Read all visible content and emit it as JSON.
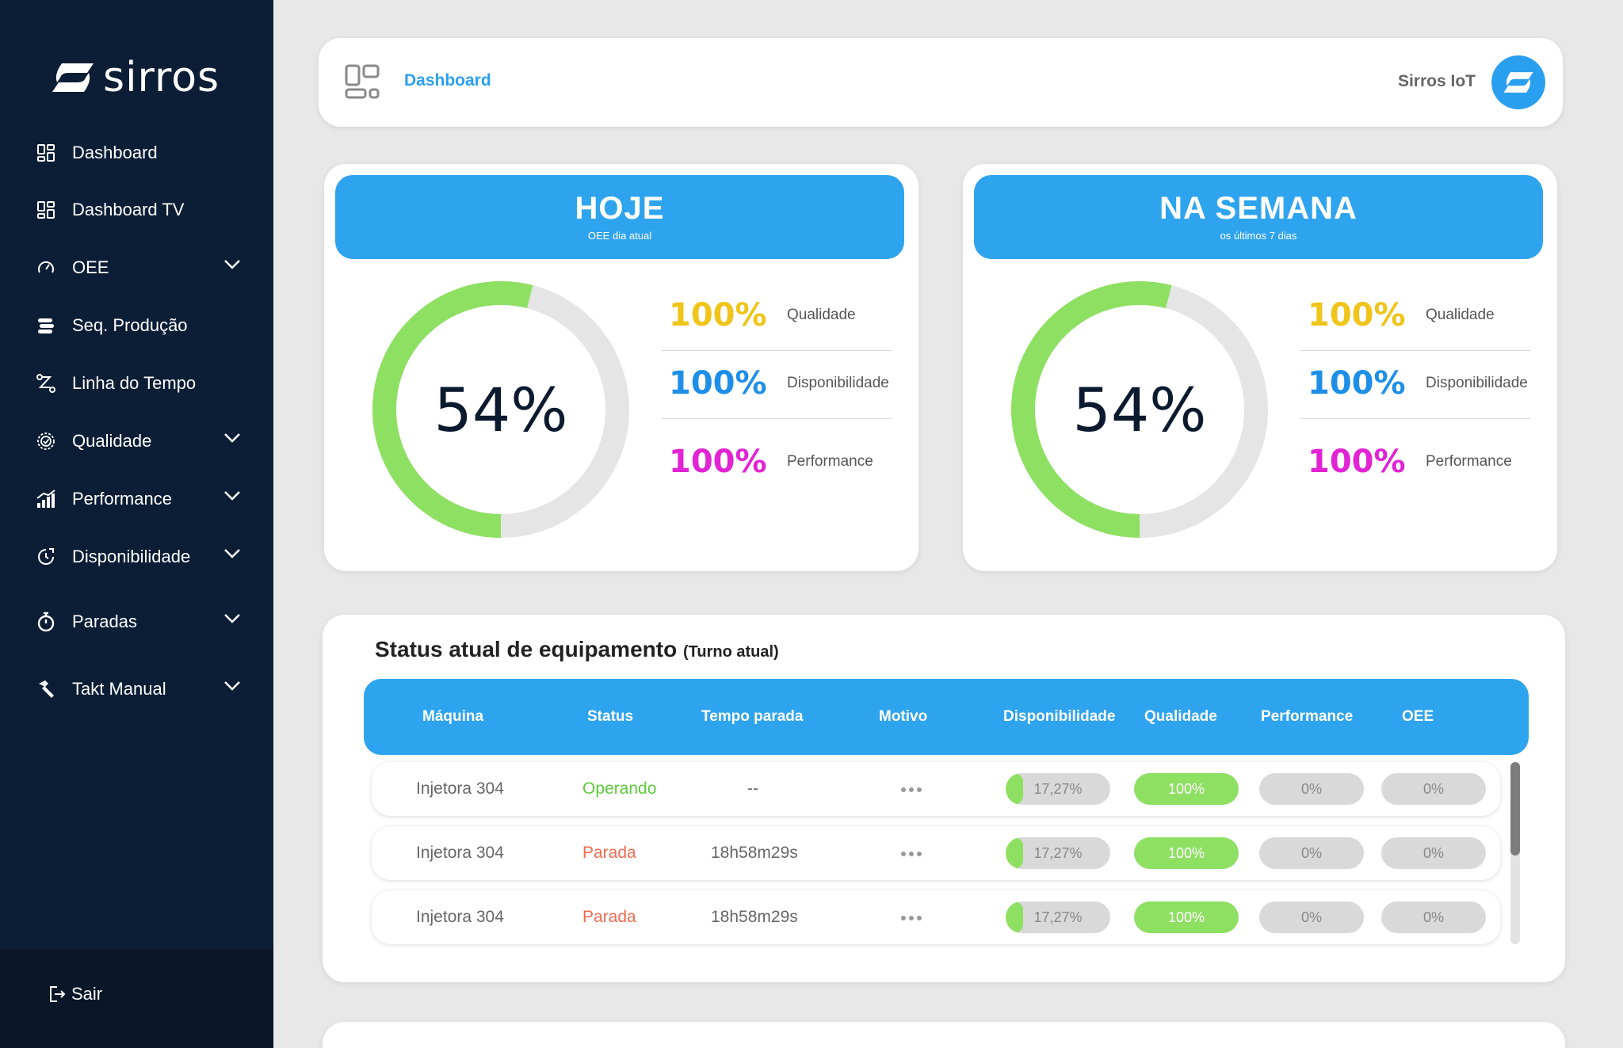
{
  "sidebar": {
    "brand": "sirros",
    "items": [
      {
        "label": "Dashboard",
        "icon": "dashboard-icon",
        "has_chevron": false
      },
      {
        "label": "Dashboard TV",
        "icon": "dashboard-tv-icon",
        "has_chevron": false
      },
      {
        "label": "OEE",
        "icon": "gauge-icon",
        "has_chevron": true
      },
      {
        "label": "Seq. Produção",
        "icon": "sequence-icon",
        "has_chevron": false
      },
      {
        "label": "Linha do Tempo",
        "icon": "timeline-icon",
        "has_chevron": false
      },
      {
        "label": "Qualidade",
        "icon": "quality-badge-icon",
        "has_chevron": true
      },
      {
        "label": "Performance",
        "icon": "performance-chart-icon",
        "has_chevron": true
      },
      {
        "label": "Disponibilidade",
        "icon": "availability-icon",
        "has_chevron": true
      },
      {
        "label": "Paradas",
        "icon": "stopwatch-icon",
        "has_chevron": true
      },
      {
        "label": "Takt Manual",
        "icon": "hammer-icon",
        "has_chevron": true
      }
    ],
    "logout_label": "Sair"
  },
  "header": {
    "title": "Dashboard",
    "user_name": "Sirros IoT"
  },
  "oee_cards": [
    {
      "title": "HOJE",
      "subtitle": "OEE dia atual",
      "oee_value": "54%",
      "oee_fraction": 0.54,
      "metrics": [
        {
          "value": "100%",
          "label": "Qualidade",
          "color": "#f0c419"
        },
        {
          "value": "100%",
          "label": "Disponibilidade",
          "color": "#1e8fe8"
        },
        {
          "value": "100%",
          "label": "Performance",
          "color": "#e223d4"
        }
      ]
    },
    {
      "title": "NA SEMANA",
      "subtitle": "os últimos 7 dias",
      "oee_value": "54%",
      "oee_fraction": 0.54,
      "metrics": [
        {
          "value": "100%",
          "label": "Qualidade",
          "color": "#f0c419"
        },
        {
          "value": "100%",
          "label": "Disponibilidade",
          "color": "#1e8fe8"
        },
        {
          "value": "100%",
          "label": "Performance",
          "color": "#e223d4"
        }
      ]
    }
  ],
  "status": {
    "title": "Status atual de equipamento",
    "title_suffix": "(Turno atual)",
    "columns": [
      "Máquina",
      "Status",
      "Tempo parada",
      "Motivo",
      "Disponibilidade",
      "Qualidade",
      "Performance",
      "OEE"
    ],
    "rows": [
      {
        "machine": "Injetora 304",
        "status": "Operando",
        "status_color": "#5ccb3a",
        "downtime": "--",
        "disponibilidade": "17,27%",
        "disponibilidade_fraction": 0.17,
        "qualidade": "100%",
        "qualidade_fraction": 1.0,
        "performance": "0%",
        "oee": "0%"
      },
      {
        "machine": "Injetora 304",
        "status": "Parada",
        "status_color": "#f26b4f",
        "downtime": "18h58m29s",
        "disponibilidade": "17,27%",
        "disponibilidade_fraction": 0.17,
        "qualidade": "100%",
        "qualidade_fraction": 1.0,
        "performance": "0%",
        "oee": "0%"
      },
      {
        "machine": "Injetora 304",
        "status": "Parada",
        "status_color": "#f26b4f",
        "downtime": "18h58m29s",
        "disponibilidade": "17,27%",
        "disponibilidade_fraction": 0.17,
        "qualidade": "100%",
        "qualidade_fraction": 1.0,
        "performance": "0%",
        "oee": "0%"
      }
    ]
  },
  "colors": {
    "sidebar_bg": "#0c1e36",
    "accent": "#2fa4ee",
    "donut_progress": "#8ee063",
    "donut_track": "#e5e5e5"
  }
}
